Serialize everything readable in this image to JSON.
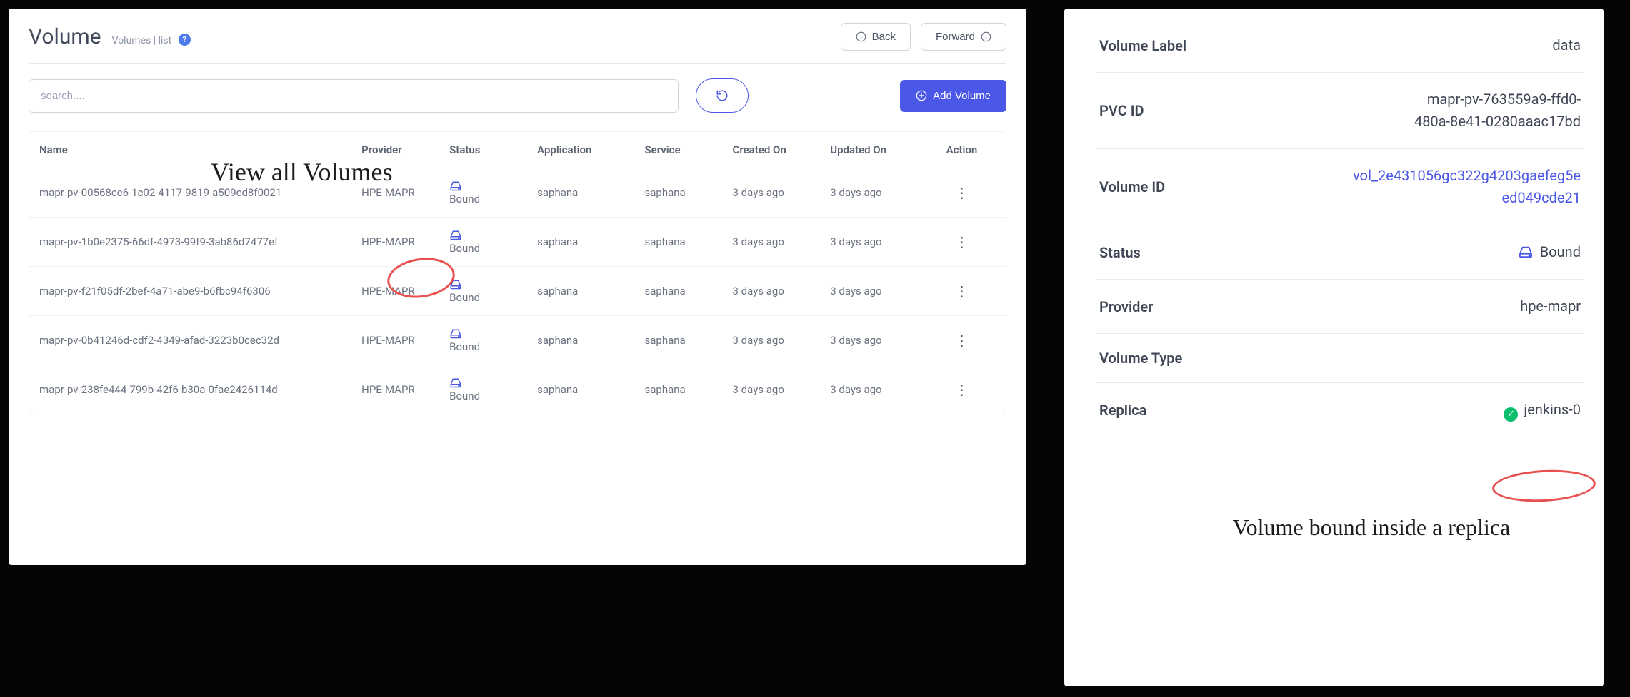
{
  "header": {
    "title": "Volume",
    "breadcrumb_parent": "Volumes",
    "breadcrumb_sep": " | ",
    "breadcrumb_current": "list",
    "back_label": "Back",
    "forward_label": "Forward"
  },
  "toolbar": {
    "search_placeholder": "search....",
    "add_volume_label": "Add Volume"
  },
  "annotations": {
    "left": "View all Volumes",
    "right": "Volume bound inside a replica"
  },
  "table": {
    "headers": {
      "name": "Name",
      "provider": "Provider",
      "status": "Status",
      "application": "Application",
      "service": "Service",
      "created_on": "Created On",
      "updated_on": "Updated On",
      "action": "Action"
    },
    "rows": [
      {
        "name": "mapr-pv-00568cc6-1c02-4117-9819-a509cd8f0021",
        "provider": "HPE-MAPR",
        "status": "Bound",
        "application": "saphana",
        "service": "saphana",
        "created_on": "3 days ago",
        "updated_on": "3 days ago"
      },
      {
        "name": "mapr-pv-1b0e2375-66df-4973-99f9-3ab86d7477ef",
        "provider": "HPE-MAPR",
        "status": "Bound",
        "application": "saphana",
        "service": "saphana",
        "created_on": "3 days ago",
        "updated_on": "3 days ago"
      },
      {
        "name": "mapr-pv-f21f05df-2bef-4a71-abe9-b6fbc94f6306",
        "provider": "HPE-MAPR",
        "status": "Bound",
        "application": "saphana",
        "service": "saphana",
        "created_on": "3 days ago",
        "updated_on": "3 days ago"
      },
      {
        "name": "mapr-pv-0b41246d-cdf2-4349-afad-3223b0cec32d",
        "provider": "HPE-MAPR",
        "status": "Bound",
        "application": "saphana",
        "service": "saphana",
        "created_on": "3 days ago",
        "updated_on": "3 days ago"
      },
      {
        "name": "mapr-pv-238fe444-799b-42f6-b30a-0fae2426114d",
        "provider": "HPE-MAPR",
        "status": "Bound",
        "application": "saphana",
        "service": "saphana",
        "created_on": "3 days ago",
        "updated_on": "3 days ago"
      }
    ]
  },
  "detail": {
    "volume_label_k": "Volume Label",
    "volume_label_v": "data",
    "pvc_id_k": "PVC ID",
    "pvc_id_v": "mapr-pv-763559a9-ffd0-480a-8e41-0280aaac17bd",
    "volume_id_k": "Volume ID",
    "volume_id_v": "vol_2e431056gc322g4203gaefeg5eed049cde21",
    "status_k": "Status",
    "status_v": "Bound",
    "provider_k": "Provider",
    "provider_v": "hpe-mapr",
    "volume_type_k": "Volume Type",
    "volume_type_v": "",
    "replica_k": "Replica",
    "replica_v": "jenkins-0"
  }
}
